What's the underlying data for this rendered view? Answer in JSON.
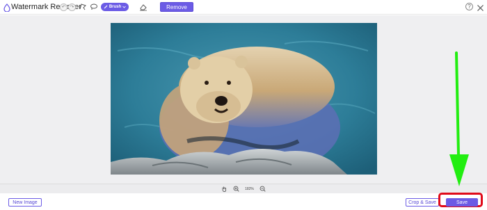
{
  "app": {
    "title": "Watermark Remover"
  },
  "toolbar": {
    "brush_label": "Brush",
    "remove_label": "Remove"
  },
  "zoom": {
    "level": "182%"
  },
  "footer": {
    "new_image_label": "New Image",
    "crop_save_label": "Crop & Save",
    "save_label": "Save"
  },
  "colors": {
    "accent": "#6b5be5",
    "highlight": "#e00a1a",
    "arrow": "#22ee11"
  },
  "icons": [
    "app-logo-icon",
    "undo-icon",
    "redo-icon",
    "polygon-lasso-icon",
    "lasso-icon",
    "brush-icon",
    "chevron-down-icon",
    "eraser-icon",
    "help-icon",
    "close-icon",
    "hand-icon",
    "zoom-in-icon",
    "zoom-out-icon"
  ]
}
